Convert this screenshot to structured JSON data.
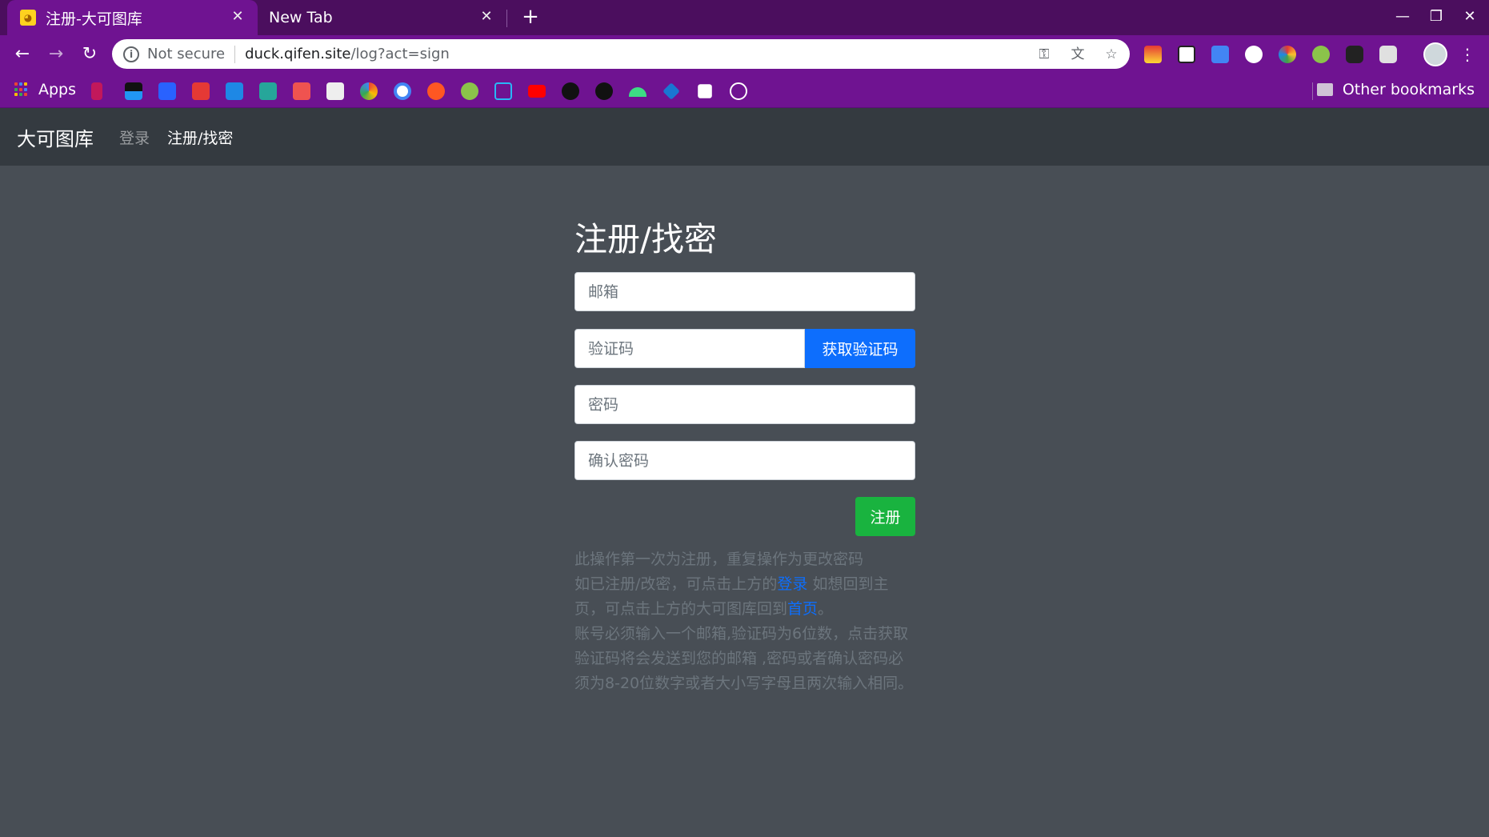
{
  "browser": {
    "tabs": [
      {
        "title": "注册-大可图库",
        "active": true
      },
      {
        "title": "New Tab",
        "active": false
      }
    ],
    "new_tab": "+",
    "close_glyph": "✕",
    "address": {
      "security_label": "Not secure",
      "host": "duck.qifen.site",
      "path": "/log?act=sign"
    },
    "bookmarks": {
      "apps_label": "Apps",
      "other_label": "Other bookmarks"
    },
    "colors": {
      "tabbar": "#4b0e5e",
      "toolbar": "#6f1391"
    }
  },
  "navbar": {
    "brand": "大可图库",
    "links": [
      "登录",
      "注册/找密"
    ]
  },
  "form": {
    "title": "注册/找密",
    "email_placeholder": "邮箱",
    "code_placeholder": "验证码",
    "get_code_label": "获取验证码",
    "password_placeholder": "密码",
    "confirm_placeholder": "确认密码",
    "submit_label": "注册"
  },
  "help": {
    "line1": "此操作第一次为注册，重复操作为更改密码",
    "part2a": "如已注册/改密，可点击上方的",
    "login_link": "登录",
    "part2b": " 如想回到主页，可点击上方的大可图库回到",
    "home_link": "首页",
    "part2c": "。",
    "line3": "账号必须输入一个邮箱,验证码为6位数，点击获取验证码将会发送到您的邮箱 ,密码或者确认密码必须为8-20位数字或者大小写字母且两次输入相同。"
  },
  "colors": {
    "page_bg": "#484e55",
    "navbar_bg": "#343a40",
    "primary": "#0d6efd",
    "success": "#19b33f"
  }
}
